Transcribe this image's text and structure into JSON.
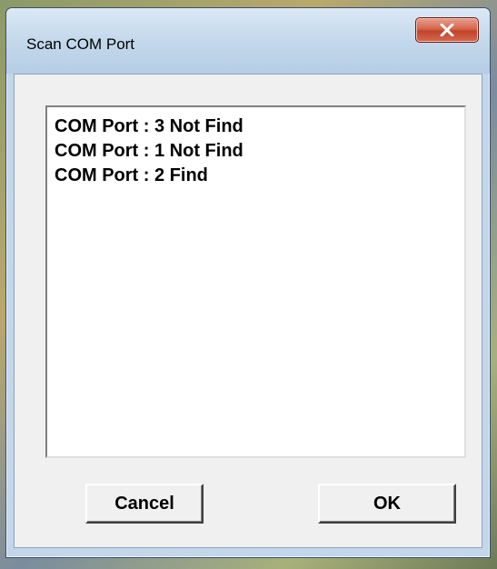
{
  "dialog": {
    "title": "Scan COM Port",
    "close_icon": "close-icon"
  },
  "list": {
    "items": [
      "COM Port : 3 Not Find",
      "COM Port : 1 Not Find",
      "COM Port : 2 Find"
    ]
  },
  "buttons": {
    "cancel_label": "Cancel",
    "ok_label": "OK"
  },
  "colors": {
    "close_button": "#c0442a",
    "title_bar": "#c4d8ec",
    "client_background": "#f0f0f0"
  }
}
